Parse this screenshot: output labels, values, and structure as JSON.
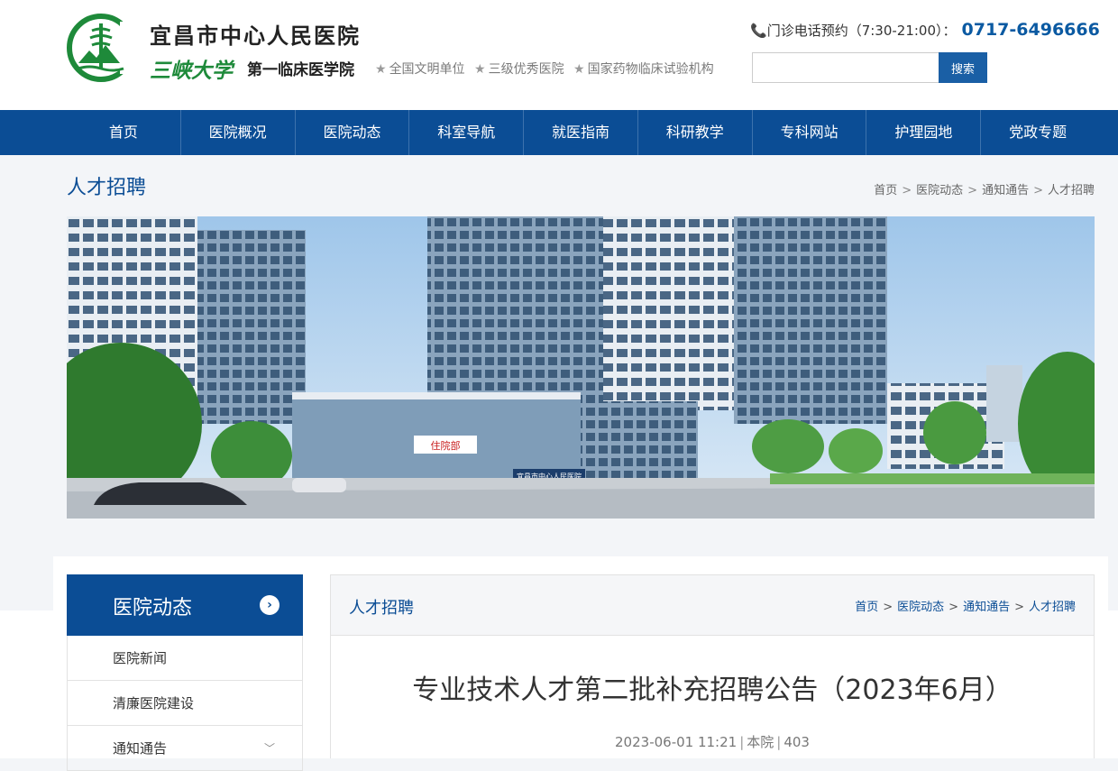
{
  "header": {
    "site_name": "宜昌市中心人民医院",
    "university": "三峡大学",
    "college": "第一临床医学院",
    "honors": [
      "全国文明单位",
      "三级优秀医院",
      "国家药物临床试验机构"
    ],
    "phone_label": "门诊电话预约（7:30-21:00）：",
    "phone_number": "0717-6496666",
    "search_placeholder": "",
    "search_button": "搜索"
  },
  "nav": {
    "items": [
      "首页",
      "医院概况",
      "医院动态",
      "科室导航",
      "就医指南",
      "科研教学",
      "专科网站",
      "护理园地",
      "党政专题"
    ]
  },
  "page": {
    "title": "人才招聘",
    "breadcrumb": [
      "首页",
      "医院动态",
      "通知通告",
      "人才招聘"
    ]
  },
  "banner": {
    "sign_building": "住院部",
    "sign_hospital": "宜昌市中心人民医院"
  },
  "sidebar": {
    "heading": "医院动态",
    "items": [
      "医院新闻",
      "清廉医院建设",
      "通知通告"
    ]
  },
  "article": {
    "panel_title": "人才招聘",
    "breadcrumb": [
      "首页",
      "医院动态",
      "通知通告",
      "人才招聘"
    ],
    "title": "专业技术人才第二批补充招聘公告（2023年6月）",
    "date": "2023-06-01 11:21",
    "source": "本院",
    "views": "403"
  },
  "colors": {
    "brand_blue": "#0b4d95",
    "logo_green": "#1e8a3a"
  }
}
